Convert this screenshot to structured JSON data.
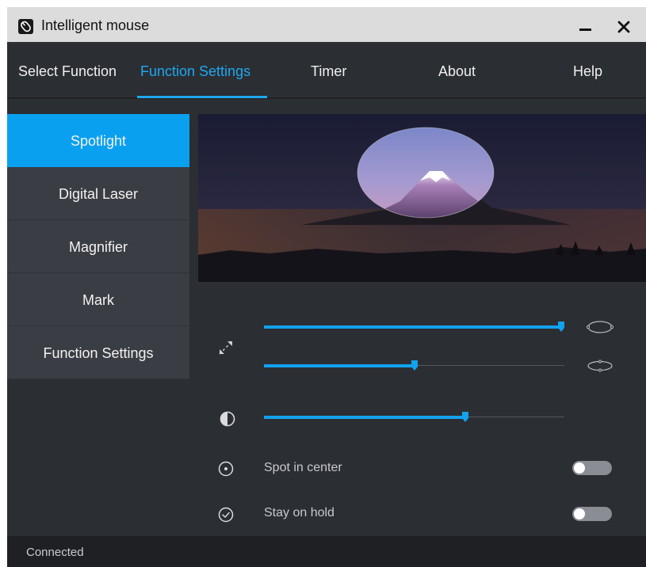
{
  "window": {
    "title": "Intelligent mouse"
  },
  "tabs": [
    {
      "label": "Select Function"
    },
    {
      "label": "Function Settings",
      "active": true
    },
    {
      "label": "Timer"
    },
    {
      "label": "About"
    },
    {
      "label": "Help"
    }
  ],
  "sidebar": {
    "items": [
      {
        "label": "Spotlight",
        "active": true
      },
      {
        "label": "Digital Laser"
      },
      {
        "label": "Magnifier"
      },
      {
        "label": "Mark"
      },
      {
        "label": "Function Settings"
      }
    ]
  },
  "spotlight": {
    "size_slider": {
      "value_percent": 99
    },
    "shape_slider": {
      "value_percent": 50
    },
    "transparency_slider": {
      "value_percent": 67
    },
    "spot_in_center": {
      "label": "Spot in center",
      "on": false
    },
    "stay_on_hold": {
      "label": "Stay on hold",
      "on": false
    }
  },
  "status": {
    "text": "Connected"
  },
  "colors": {
    "accent": "#0aa0f0",
    "background": "#2b2e33",
    "sidebar_item": "#3a3e44",
    "titlebar": "#dcdcdc",
    "statusbar": "#1e2023"
  },
  "icons": {
    "app": "mouse-app-icon",
    "minimize": "minimize-icon",
    "close": "close-icon",
    "size": "resize-arrows-icon",
    "size_max": "large-ellipse-icon",
    "size_min": "small-ellipse-icon",
    "transparency": "contrast-icon",
    "center": "target-circle-icon",
    "hold": "check-circle-icon"
  }
}
